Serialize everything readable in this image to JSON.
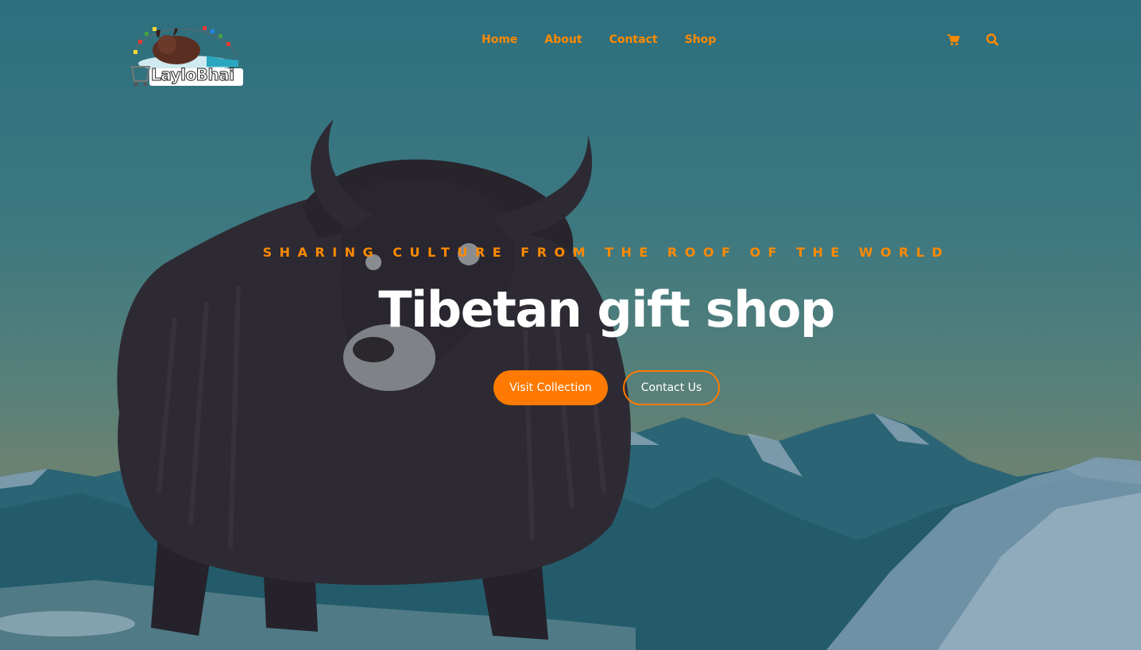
{
  "brand": {
    "logo_text": "LayloBhai"
  },
  "nav": {
    "items": [
      {
        "label": "Home"
      },
      {
        "label": "About"
      },
      {
        "label": "Contact"
      },
      {
        "label": "Shop"
      }
    ]
  },
  "header_icons": {
    "cart_icon": "shopping-cart-icon",
    "search_icon": "magnifier-icon"
  },
  "hero": {
    "tagline": "SHARING CULTURE FROM THE ROOF OF THE WORLD",
    "title": "Tibetan gift shop",
    "primary_button": "Visit Collection",
    "secondary_button": "Contact Us"
  },
  "colors": {
    "accent": "#ff7a00",
    "nav_text": "#ff8a00",
    "sky_top": "#2d6f7e",
    "sky_bottom": "#6b8272",
    "mountain": "#2f6a7a",
    "yak": "#2a2630"
  }
}
